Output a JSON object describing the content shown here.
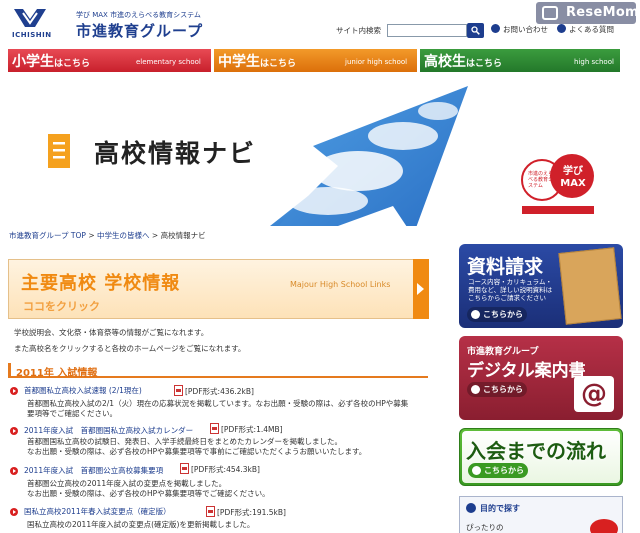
{
  "header": {
    "logo_en": "ICHISHIN",
    "logo_tagline": "学び MAX 市進のえらべる教育システム",
    "logo_name": "市進教育グループ",
    "search_label": "サイト内検索",
    "search_placeholder": "",
    "links": [
      "お問い合わせ",
      "よくある質問"
    ],
    "watermark": "ReseMom"
  },
  "gnav": [
    {
      "label": "小学生",
      "suffix": "はこちら",
      "sub": "elementary school",
      "color": "#d42a35"
    },
    {
      "label": "中学生",
      "suffix": "はこちら",
      "sub": "junior high school",
      "color": "#e8801a"
    },
    {
      "label": "高校生",
      "suffix": "はこちら",
      "sub": "high school",
      "color": "#2e8a33"
    }
  ],
  "hero": {
    "title": "高校情報ナビ",
    "badge_small": "市進のえらべる教育システム",
    "badge_main": "学びMAX"
  },
  "breadcrumb": {
    "items": [
      "市進教育グループ TOP",
      "中学生の皆様へ",
      "高校情報ナビ"
    ],
    "sep": " > "
  },
  "banner": {
    "title": "主要高校 学校情報",
    "cta": "ココをクリック",
    "en": "Majour High School Links"
  },
  "intro": [
    "学校説明会、文化祭・体育祭等の情報がご覧になれます。",
    "また高校名をクリックすると各校のホームページをご覧になれます。"
  ],
  "section_title": "2011年 入試情報",
  "items": [
    {
      "title": "首都圏私立高校入試速報 (2/1現在)",
      "pdf": "[PDF形式:436.2kB]",
      "desc": [
        "首都圏私立高校入試の2/1（火）現在の応募状況を掲載しています。なお出願・受験の際は、必ず各校のHPや募集",
        "要項等でご確認ください。"
      ]
    },
    {
      "title": "2011年度入試　首都圏国私立高校入試カレンダー",
      "pdf": "[PDF形式:1.4MB]",
      "desc": [
        "首都圏国私立高校の試験日、発表日、入学手続最終日をまとめたカレンダーを掲載しました。",
        "なお出願・受験の際は、必ず各校のHPや募集要項等で事前にご確認いただくようお願いいたします。"
      ]
    },
    {
      "title": "2011年度入試　首都圏公立高校募集要項",
      "pdf": "[PDF形式:454.3kB]",
      "desc": [
        "首都圏公立高校の2011年度入試の変更点を掲載しました。",
        "なお出願・受験の際は、必ず各校のHPや募集要項等でご確認ください。"
      ]
    },
    {
      "title": "国私立高校2011年春入試変更点（確定版）",
      "pdf": "[PDF形式:191.5kB]",
      "desc": [
        "国私立高校の2011年度入試の変更点(確定版)を更新掲載しました。"
      ]
    }
  ],
  "sidebar": {
    "request": {
      "title": "資料請求",
      "desc": [
        "コース内容・カリキュラム・",
        "費用など、詳しい説明資料は",
        "こちらからご請求ください"
      ],
      "go": "こちらから"
    },
    "digital": {
      "top": "市進教育グループ",
      "title": "デジタル案内書",
      "go": "こちらから",
      "at": "@"
    },
    "flow": {
      "title": "入会までの流れ",
      "go": "こちらから"
    },
    "search": {
      "title": "目的で探す",
      "first": "ぴったりの"
    }
  }
}
